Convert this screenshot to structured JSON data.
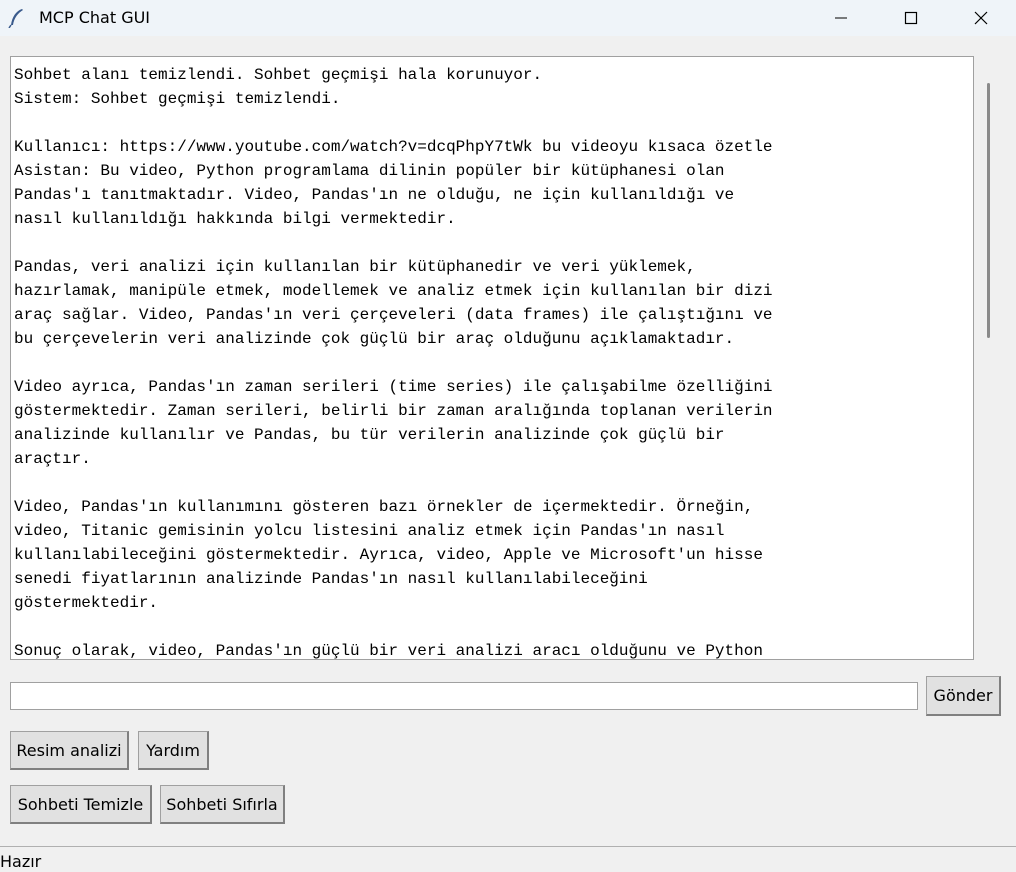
{
  "window": {
    "title": "MCP Chat GUI",
    "icon": "feather-icon"
  },
  "chat": {
    "lines": [
      "Sohbet alanı temizlendi. Sohbet geçmişi hala korunuyor.",
      "Sistem: Sohbet geçmişi temizlendi.",
      "",
      "Kullanıcı: https://www.youtube.com/watch?v=dcqPhpY7tWk bu videoyu kısaca özetle",
      "Asistan: Bu video, Python programlama dilinin popüler bir kütüphanesi olan",
      "Pandas'ı tanıtmaktadır. Video, Pandas'ın ne olduğu, ne için kullanıldığı ve",
      "nasıl kullanıldığı hakkında bilgi vermektedir.",
      "",
      "Pandas, veri analizi için kullanılan bir kütüphanedir ve veri yüklemek,",
      "hazırlamak, manipüle etmek, modellemek ve analiz etmek için kullanılan bir dizi",
      "araç sağlar. Video, Pandas'ın veri çerçeveleri (data frames) ile çalıştığını ve",
      "bu çerçevelerin veri analizinde çok güçlü bir araç olduğunu açıklamaktadır.",
      "",
      "Video ayrıca, Pandas'ın zaman serileri (time series) ile çalışabilme özelliğini",
      "göstermektedir. Zaman serileri, belirli bir zaman aralığında toplanan verilerin",
      "analizinde kullanılır ve Pandas, bu tür verilerin analizinde çok güçlü bir",
      "araçtır.",
      "",
      "Video, Pandas'ın kullanımını gösteren bazı örnekler de içermektedir. Örneğin,",
      "video, Titanic gemisinin yolcu listesini analiz etmek için Pandas'ın nasıl",
      "kullanılabileceğini göstermektedir. Ayrıca, video, Apple ve Microsoft'un hisse",
      "senedi fiyatlarının analizinde Pandas'ın nasıl kullanılabileceğini",
      "göstermektedir.",
      "",
      "Sonuç olarak, video, Pandas'ın güçlü bir veri analizi aracı olduğunu ve Python"
    ]
  },
  "input": {
    "value": "",
    "placeholder": ""
  },
  "buttons": {
    "send": "Gönder",
    "image_analysis": "Resim analizi",
    "help": "Yardım",
    "clear_chat": "Sohbeti Temizle",
    "reset_chat": "Sohbeti Sıfırla"
  },
  "status": {
    "text": "Hazır"
  }
}
